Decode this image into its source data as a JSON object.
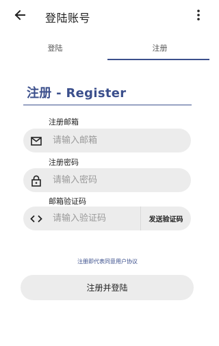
{
  "appbar": {
    "title": "登陆账号",
    "back_icon": "arrow-left-icon",
    "more_icon": "more-vert-icon"
  },
  "tabs": [
    {
      "label": "登陆",
      "selected": false
    },
    {
      "label": "注册",
      "selected": true
    }
  ],
  "form": {
    "heading": "注册 - Register",
    "email": {
      "label": "注册邮箱",
      "placeholder": "请输入邮箱",
      "icon": "mail-icon"
    },
    "password": {
      "label": "注册密码",
      "placeholder": "请输入密码",
      "icon": "lock-icon"
    },
    "code": {
      "label": "邮箱验证码",
      "placeholder": "请输入验证码",
      "icon": "code-icon",
      "send_label": "发送验证码"
    },
    "agreement": "注册即代表同意用户协议",
    "submit_label": "注册并登陆"
  },
  "colors": {
    "accent": "#3b4f8c",
    "field_bg": "#ececec",
    "placeholder": "#9a9a9a"
  }
}
